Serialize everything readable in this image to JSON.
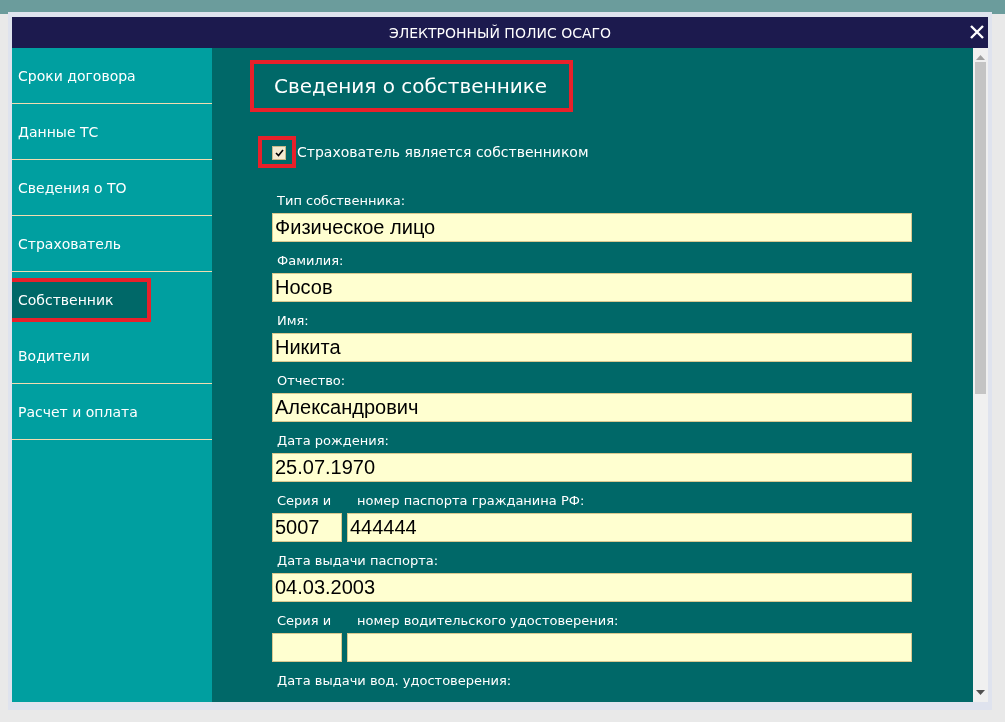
{
  "window": {
    "title": "ЭЛЕКТРОННЫЙ ПОЛИС ОСАГО"
  },
  "sidebar": {
    "items": [
      {
        "label": "Сроки договора",
        "selected": false,
        "highlighted": false
      },
      {
        "label": "Данные ТС",
        "selected": false,
        "highlighted": false
      },
      {
        "label": "Сведения о ТО",
        "selected": false,
        "highlighted": false
      },
      {
        "label": "Страхователь",
        "selected": false,
        "highlighted": false
      },
      {
        "label": "Собственник",
        "selected": true,
        "highlighted": true
      },
      {
        "label": "Водители",
        "selected": false,
        "highlighted": false
      },
      {
        "label": "Расчет и оплата",
        "selected": false,
        "highlighted": false
      }
    ]
  },
  "section": {
    "heading": "Сведения о собственнике",
    "highlighted": true
  },
  "owner_checkbox": {
    "label": "Страхователь является собственником",
    "checked": true,
    "highlighted": true
  },
  "fields": [
    {
      "kind": "single",
      "label": "Тип собственника:",
      "value": "Физическое лицо"
    },
    {
      "kind": "single",
      "label": "Фамилия:",
      "value": "Носов"
    },
    {
      "kind": "single",
      "label": "Имя:",
      "value": "Никита"
    },
    {
      "kind": "single",
      "label": "Отчество:",
      "value": "Александрович"
    },
    {
      "kind": "single",
      "label": "Дата рождения:",
      "value": "25.07.1970"
    },
    {
      "kind": "split",
      "parts": [
        {
          "label": "Серия и",
          "value": "5007"
        },
        {
          "label": "номер паспорта гражданина РФ:",
          "value": "444444"
        }
      ]
    },
    {
      "kind": "single",
      "label": "Дата выдачи паспорта:",
      "value": "04.03.2003"
    },
    {
      "kind": "split",
      "parts": [
        {
          "label": "Серия и"
        },
        {
          "label": "номер водительского удостоверения:"
        }
      ]
    },
    {
      "kind": "caption",
      "label": "Дата выдачи вод. удостоверения:"
    }
  ]
}
